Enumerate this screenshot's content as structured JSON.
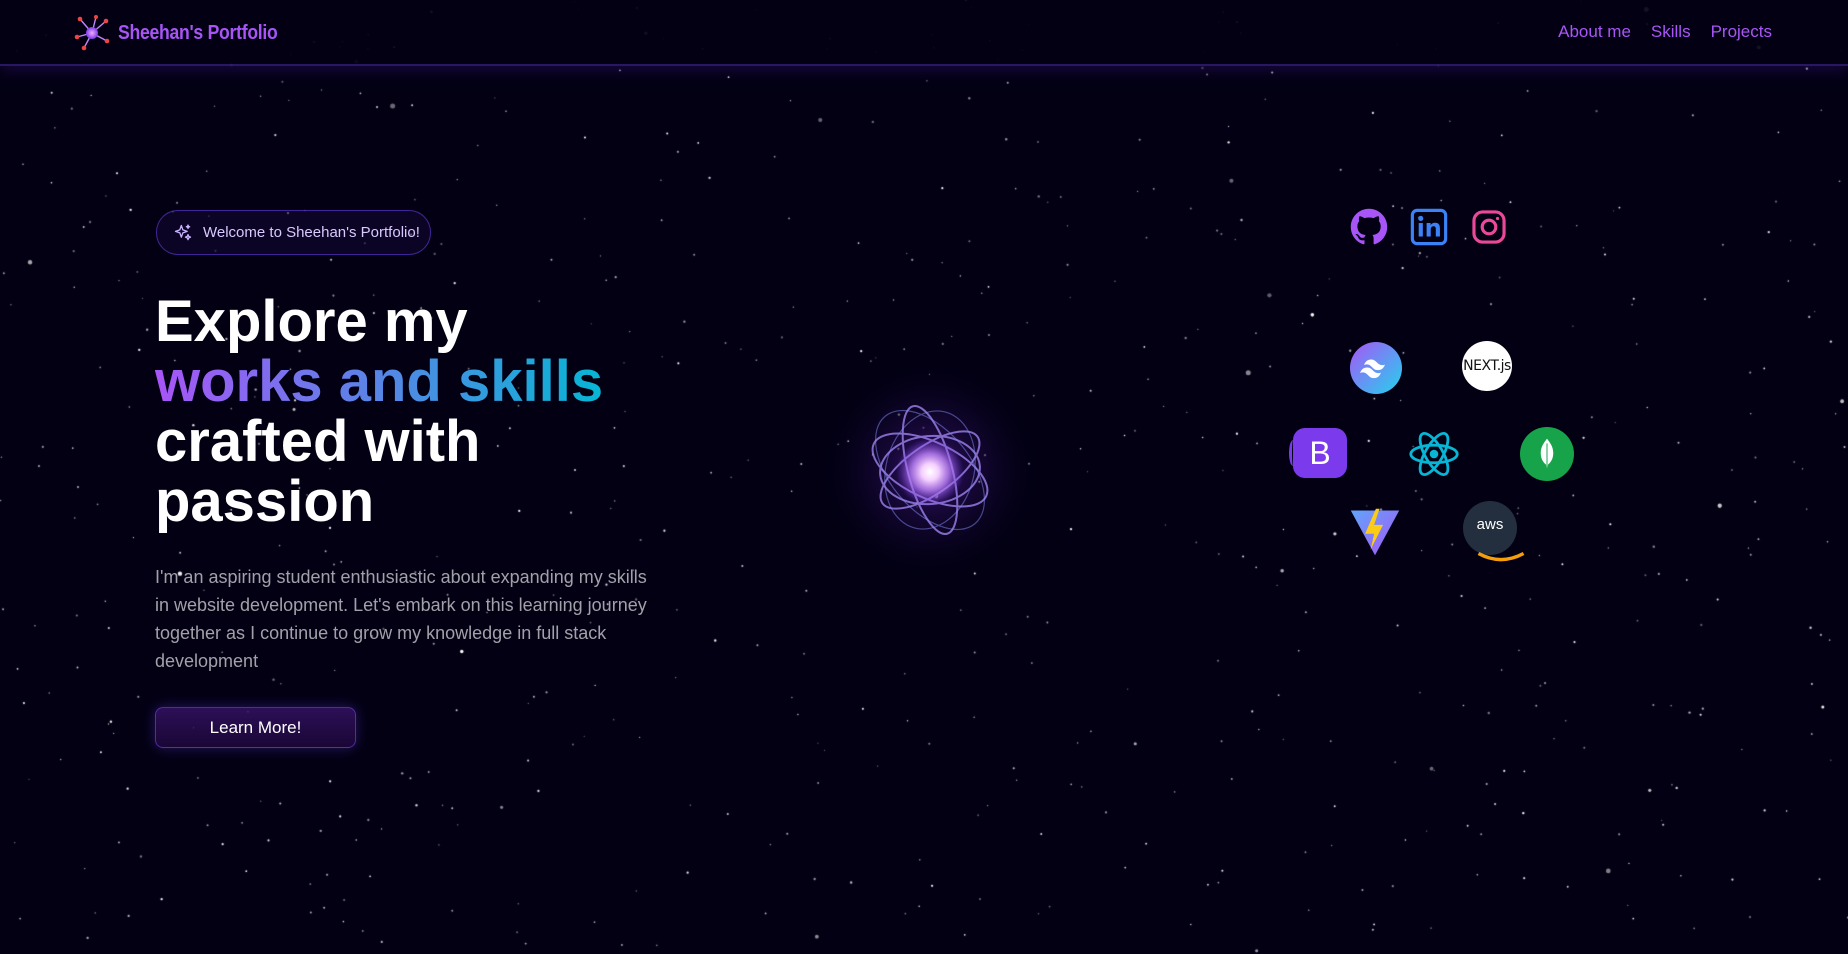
{
  "navbar": {
    "brand_name": "Sheehan's Portfolio",
    "logo_icon": "atom-network-icon",
    "links": [
      {
        "label": "About me"
      },
      {
        "label": "Skills"
      },
      {
        "label": "Projects"
      }
    ]
  },
  "hero": {
    "welcome_badge": "Welcome to Sheehan's Portfolio!",
    "headline": {
      "line1": "Explore my",
      "line2_gradient": "works and skills",
      "line3": "crafted with",
      "line4": "passion"
    },
    "description": "I'm an aspiring student enthusiastic about expanding my skills in website development. Let's embark on this learning journey together as I continue to grow my knowledge in full stack development",
    "cta_label": "Learn More!"
  },
  "social_links": [
    {
      "icon": "github-icon",
      "color": "#a855f7"
    },
    {
      "icon": "linkedin-icon",
      "color": "#3b82f6"
    },
    {
      "icon": "instagram-icon",
      "color": "#ec4899"
    }
  ],
  "tech_stack": [
    {
      "icon": "tailwind-icon"
    },
    {
      "icon": "nextjs-icon",
      "label": "NEXT.js"
    },
    {
      "icon": "bootstrap-icon",
      "label": "B"
    },
    {
      "icon": "react-icon"
    },
    {
      "icon": "mongodb-icon"
    },
    {
      "icon": "vite-icon"
    },
    {
      "icon": "aws-icon",
      "label": "aws"
    }
  ],
  "colors": {
    "background": "#030014",
    "accent_purple": "#a855f7",
    "accent_cyan": "#06b6d4"
  }
}
